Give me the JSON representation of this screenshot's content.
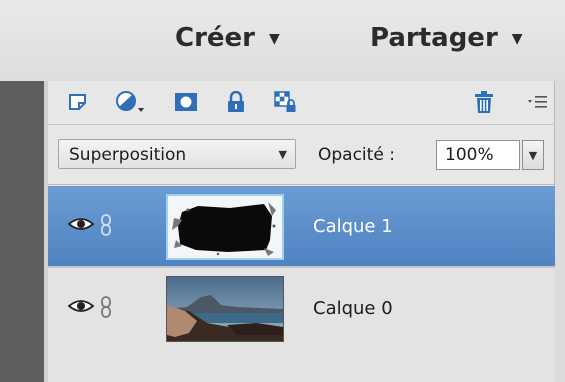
{
  "header": {
    "create_label": "Créer",
    "share_label": "Partager",
    "dropdown_glyph": "▼"
  },
  "toolbar": {
    "icons": [
      "new-layer-icon",
      "adjustment-layer-icon",
      "layer-mask-icon",
      "lock-all-icon",
      "lock-transparency-icon",
      "trash-icon",
      "panel-menu-icon"
    ]
  },
  "blend": {
    "mode": "Superposition",
    "opacity_label": "Opacité :",
    "opacity_value": "100%"
  },
  "layers": [
    {
      "name": "Calque 1",
      "selected": true
    },
    {
      "name": "Calque 0",
      "selected": false
    }
  ],
  "colors": {
    "selection": "#5a8ecb",
    "icon_blue": "#2e6fb8"
  }
}
